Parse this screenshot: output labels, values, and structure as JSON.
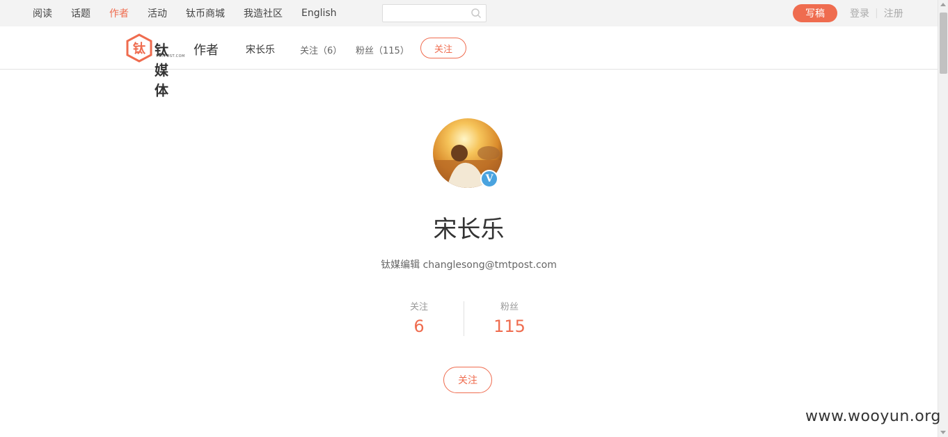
{
  "topnav": {
    "items": [
      {
        "label": "阅读",
        "active": false
      },
      {
        "label": "话题",
        "active": false
      },
      {
        "label": "作者",
        "active": true
      },
      {
        "label": "活动",
        "active": false
      },
      {
        "label": "钛币商城",
        "active": false
      },
      {
        "label": "我造社区",
        "active": false
      },
      {
        "label": "English",
        "active": false
      }
    ],
    "search_value": "",
    "write_label": "写稿",
    "login_label": "登录",
    "register_label": "注册"
  },
  "subbar": {
    "logo_text": "钛媒体",
    "logo_subtext": "TMTPOST.COM",
    "section_title": "作者",
    "author_name": "宋长乐",
    "follow_count_label": "关注（6）",
    "fans_count_label": "粉丝（115）",
    "follow_button_label": "关注"
  },
  "profile": {
    "name": "宋长乐",
    "verified_badge": "V",
    "bio": "钛媒编辑 changlesong@tmtpost.com",
    "stats": {
      "follow_label": "关注",
      "follow_value": "6",
      "fans_label": "粉丝",
      "fans_value": "115"
    },
    "follow_button_label": "关注"
  },
  "watermark": "www.wooyun.org",
  "colors": {
    "accent": "#ef6c4f",
    "verified": "#4aa3df",
    "topbar_bg": "#f3f3f3"
  }
}
